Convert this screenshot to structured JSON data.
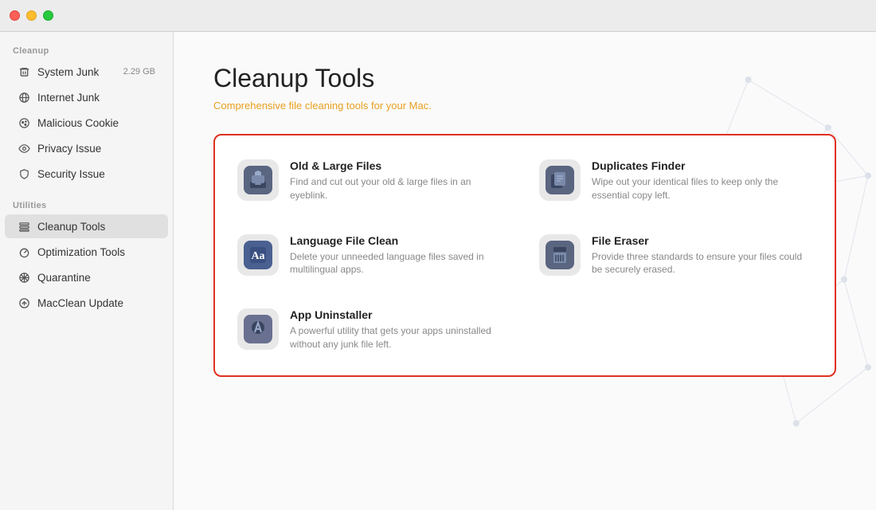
{
  "titlebar": {
    "lights": [
      "red",
      "yellow",
      "green"
    ]
  },
  "sidebar": {
    "cleanup_label": "Cleanup",
    "utilities_label": "Utilities",
    "items_cleanup": [
      {
        "id": "system-junk",
        "label": "System Junk",
        "badge": "2.29 GB",
        "icon": "trash"
      },
      {
        "id": "internet-junk",
        "label": "Internet Junk",
        "badge": "",
        "icon": "globe"
      },
      {
        "id": "malicious-cookie",
        "label": "Malicious Cookie",
        "badge": "",
        "icon": "cookie"
      },
      {
        "id": "privacy-issue",
        "label": "Privacy Issue",
        "badge": "",
        "icon": "eye"
      },
      {
        "id": "security-issue",
        "label": "Security Issue",
        "badge": "",
        "icon": "shield"
      }
    ],
    "items_utilities": [
      {
        "id": "cleanup-tools",
        "label": "Cleanup Tools",
        "badge": "",
        "icon": "wrench",
        "active": true
      },
      {
        "id": "optimization-tools",
        "label": "Optimization Tools",
        "badge": "",
        "icon": "gauge"
      },
      {
        "id": "quarantine",
        "label": "Quarantine",
        "badge": "",
        "icon": "quarantine"
      },
      {
        "id": "macclean-update",
        "label": "MacClean Update",
        "badge": "",
        "icon": "arrow-up"
      }
    ]
  },
  "main": {
    "title": "Cleanup Tools",
    "subtitle": "Comprehensive file cleaning tools for your Mac.",
    "tools": [
      {
        "id": "old-large-files",
        "name": "Old & Large Files",
        "desc": "Find and cut out your old & large files in an eyeblink.",
        "icon": "archive"
      },
      {
        "id": "duplicates-finder",
        "name": "Duplicates Finder",
        "desc": "Wipe out your identical files to keep only the essential copy left.",
        "icon": "duplicate"
      },
      {
        "id": "language-file-clean",
        "name": "Language File Clean",
        "desc": "Delete your unneeded language files saved in multilingual apps.",
        "icon": "language"
      },
      {
        "id": "file-eraser",
        "name": "File Eraser",
        "desc": "Provide three standards to ensure your files could be securely erased.",
        "icon": "eraser"
      },
      {
        "id": "app-uninstaller",
        "name": "App Uninstaller",
        "desc": "A powerful utility that gets your apps uninstalled without any junk file left.",
        "icon": "uninstaller"
      }
    ]
  }
}
